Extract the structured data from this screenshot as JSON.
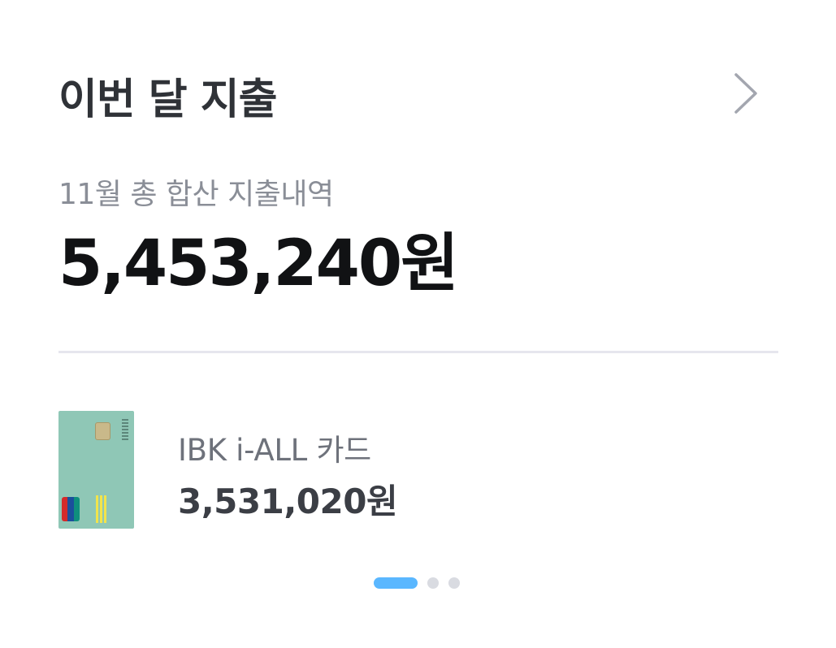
{
  "header": {
    "title": "이번 달 지출",
    "chevron_icon": "chevron-right-icon"
  },
  "summary": {
    "label": "11월 총 합산 지출내역",
    "total_amount": "5,453,240원"
  },
  "cards": [
    {
      "name": "IBK i-ALL 카드",
      "amount": "3,531,020원",
      "card_color": "#8fc7b6"
    }
  ],
  "pager": {
    "count": 3,
    "active_index": 0,
    "active_color": "#5ab7ff",
    "inactive_color": "#d9dbe1"
  }
}
